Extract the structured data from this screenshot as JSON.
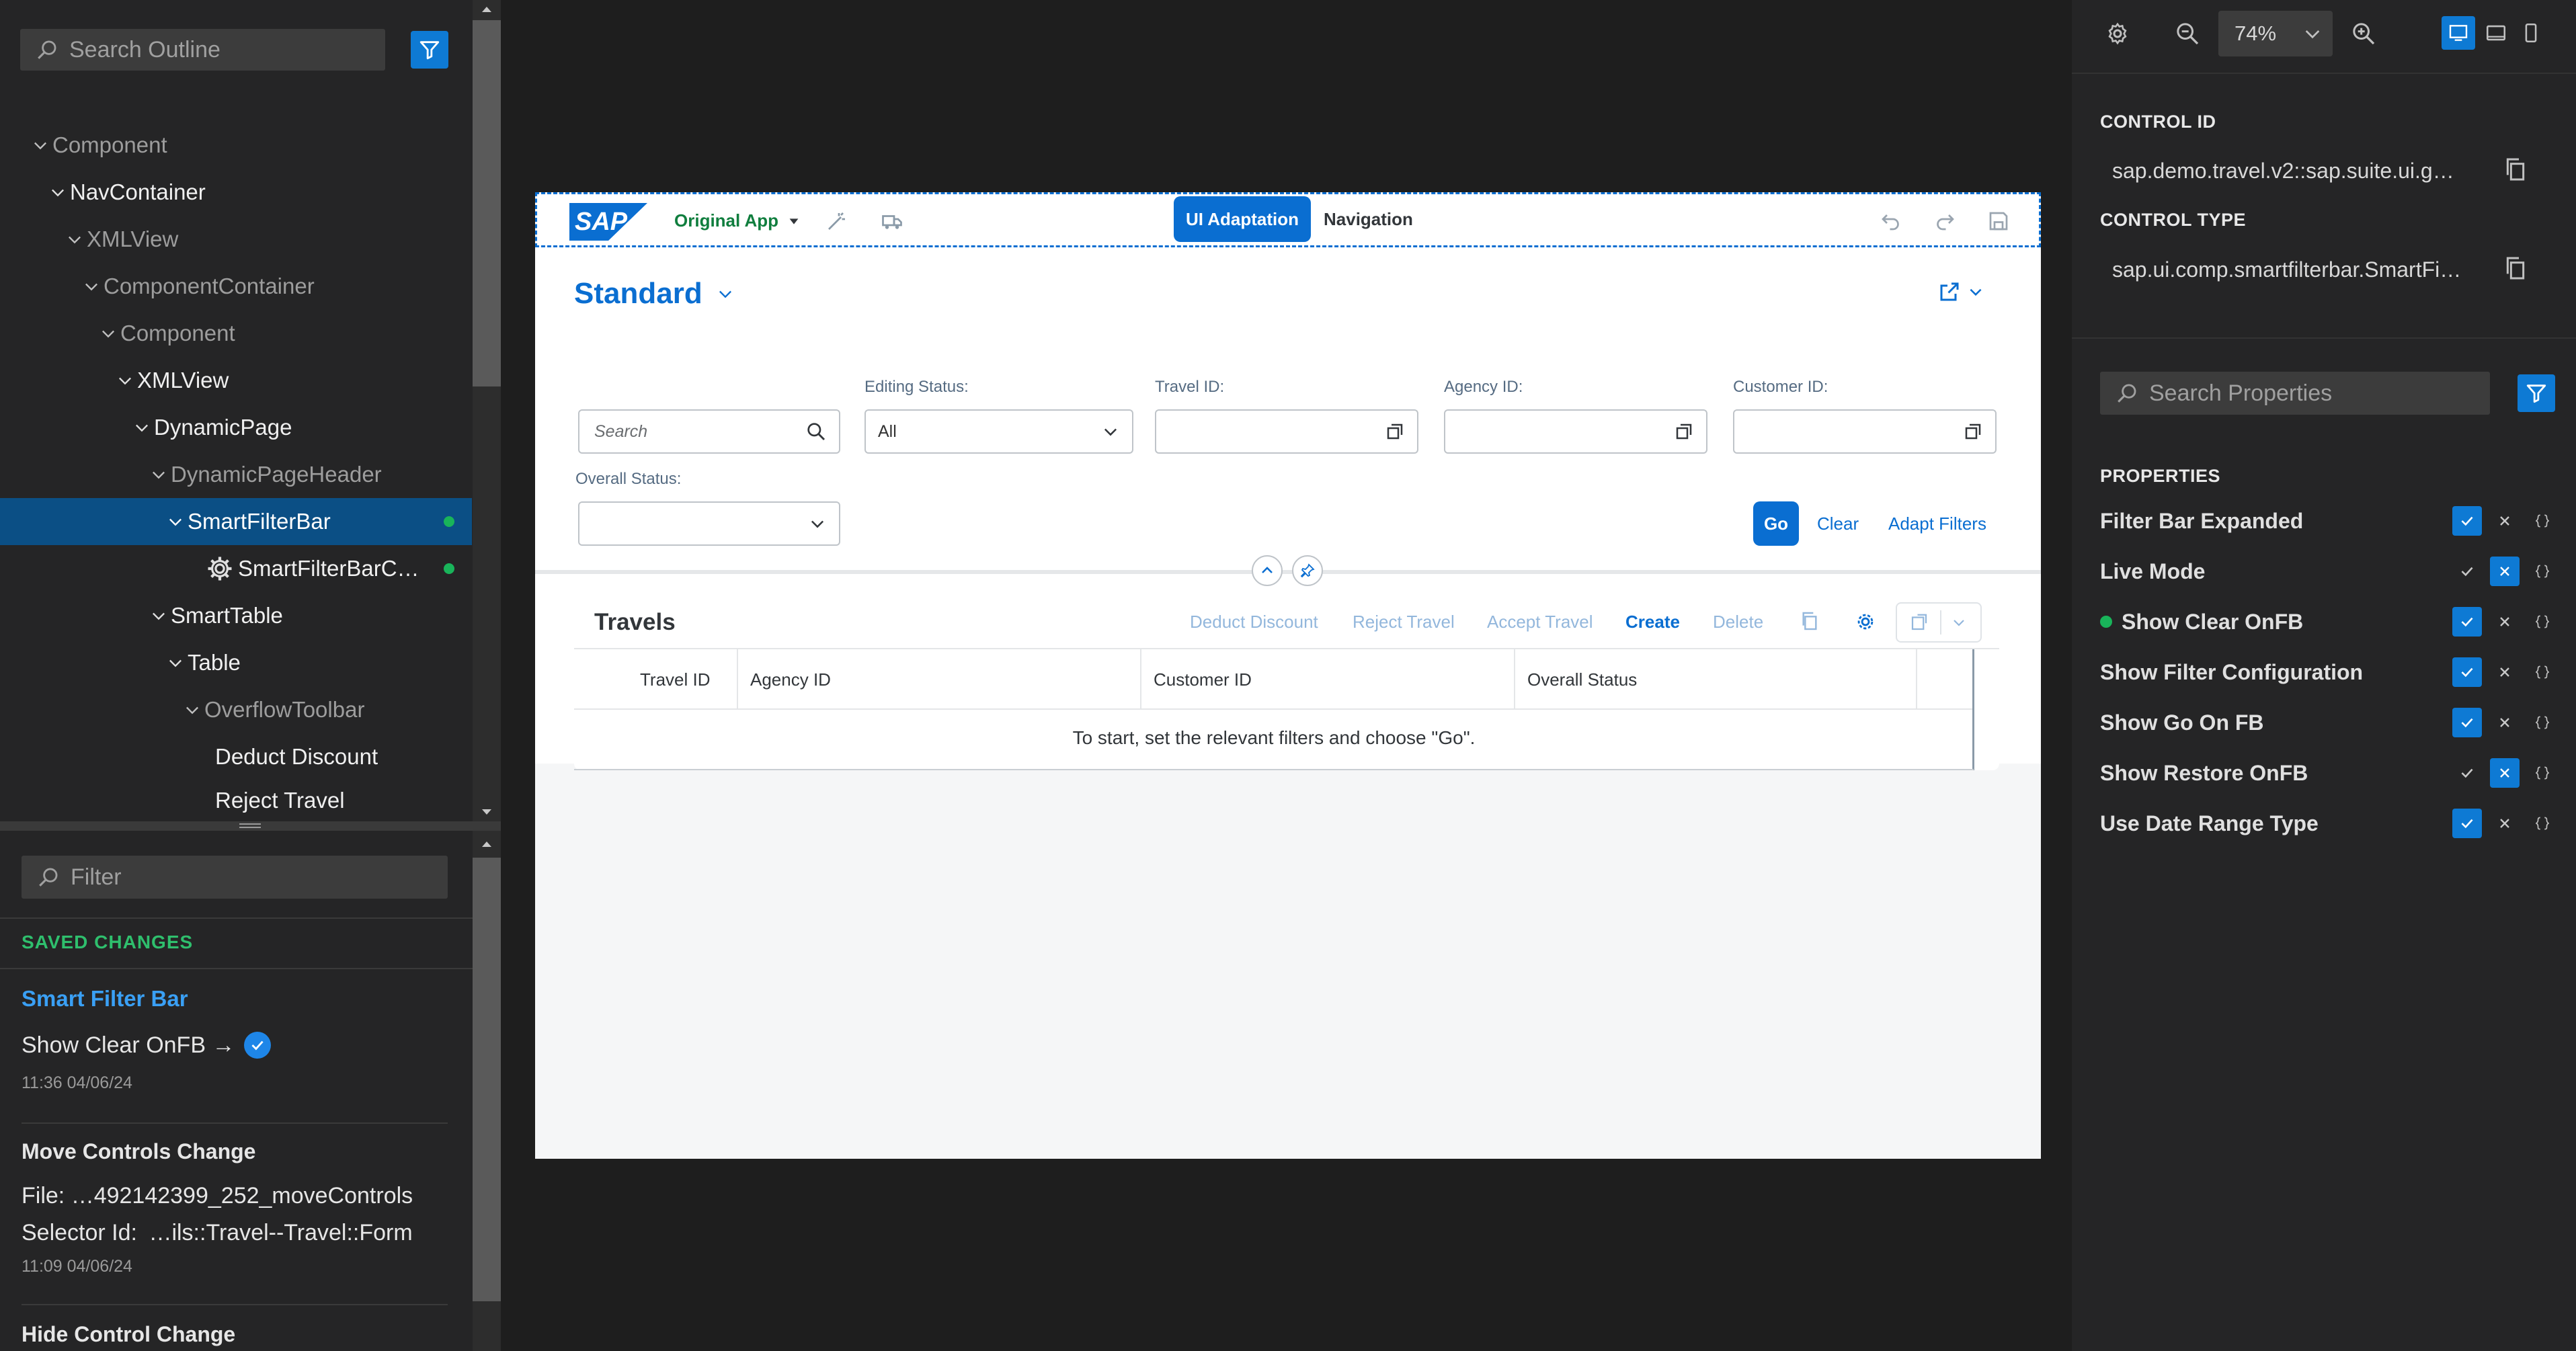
{
  "outline": {
    "search_placeholder": "Search Outline",
    "items": [
      {
        "label": "Component"
      },
      {
        "label": "NavContainer"
      },
      {
        "label": "XMLView"
      },
      {
        "label": "ComponentContainer"
      },
      {
        "label": "Component"
      },
      {
        "label": "XMLView"
      },
      {
        "label": "DynamicPage"
      },
      {
        "label": "DynamicPageHeader"
      },
      {
        "label": "SmartFilterBar"
      },
      {
        "label": "SmartFilterBarC…"
      },
      {
        "label": "SmartTable"
      },
      {
        "label": "Table"
      },
      {
        "label": "OverflowToolbar"
      },
      {
        "label": "Deduct Discount"
      },
      {
        "label": "Reject Travel"
      }
    ]
  },
  "changes": {
    "filter_placeholder": "Filter",
    "section_title": "SAVED CHANGES",
    "group_title": "Smart Filter Bar",
    "entry1": {
      "text": "Show Clear OnFB →",
      "time": "11:36 04/06/24"
    },
    "entry2": {
      "title": "Move Controls Change",
      "file_label": "File:",
      "file_value": "…492142399_252_moveControls",
      "selector_label": "Selector Id:",
      "selector_value": "…ils::Travel--Travel::Form",
      "time": "11:09 04/06/24"
    },
    "entry3": {
      "title": "Hide Control Change"
    }
  },
  "app": {
    "shell": {
      "logo": "SAP",
      "app_menu": "Original App",
      "ui_adaptation": "UI Adaptation",
      "navigation": "Navigation"
    },
    "variant": "Standard",
    "filters": {
      "search_placeholder": "Search",
      "editing_status_label": "Editing Status:",
      "editing_status_value": "All",
      "travel_id_label": "Travel ID:",
      "agency_id_label": "Agency ID:",
      "customer_id_label": "Customer ID:",
      "overall_status_label": "Overall Status:",
      "go": "Go",
      "clear": "Clear",
      "adapt": "Adapt Filters"
    },
    "table": {
      "title": "Travels",
      "actions": {
        "deduct": "Deduct Discount",
        "reject": "Reject Travel",
        "accept": "Accept Travel",
        "create": "Create",
        "delete": "Delete"
      },
      "columns": [
        "Travel ID",
        "Agency ID",
        "Customer ID",
        "Overall Status"
      ],
      "empty_text": "To start, set the relevant filters and choose \"Go\"."
    }
  },
  "toolbar": {
    "zoom": "74%"
  },
  "properties_panel": {
    "control_id_label": "CONTROL ID",
    "control_id_value": "sap.demo.travel.v2::sap.suite.ui.g…",
    "control_type_label": "CONTROL TYPE",
    "control_type_value": "sap.ui.comp.smartfilterbar.SmartFi…",
    "search_placeholder": "Search Properties",
    "section_title": "PROPERTIES",
    "properties": [
      {
        "name": "Filter Bar Expanded",
        "value": true,
        "changed": false
      },
      {
        "name": "Live Mode",
        "value": false,
        "changed": false
      },
      {
        "name": "Show Clear OnFB",
        "value": true,
        "changed": true
      },
      {
        "name": "Show Filter Configuration",
        "value": true,
        "changed": false
      },
      {
        "name": "Show Go On FB",
        "value": true,
        "changed": false
      },
      {
        "name": "Show Restore OnFB",
        "value": false,
        "changed": false
      },
      {
        "name": "Use Date Range Type",
        "value": true,
        "changed": false
      }
    ]
  },
  "colors": {
    "accent": "#0e7ad4",
    "selection": "#0b4f85",
    "changed_dot": "#19b45a",
    "sap_blue": "#0a6ed1"
  }
}
